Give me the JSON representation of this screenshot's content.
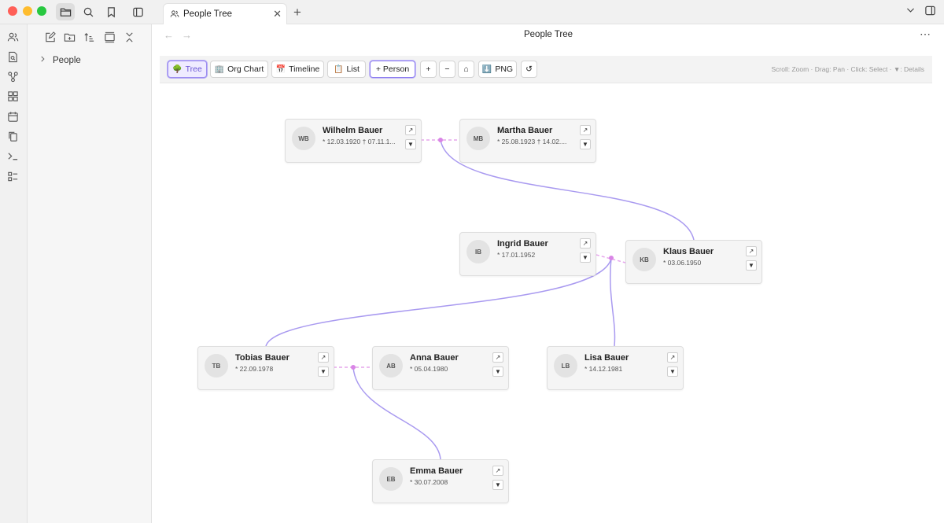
{
  "tab": {
    "title": "People Tree",
    "icon": "people-icon"
  },
  "view": {
    "title": "People Tree"
  },
  "sidebar": {
    "folders": [
      {
        "label": "People",
        "collapsed": true
      }
    ]
  },
  "toolbar": {
    "tree": "Tree",
    "org_chart": "Org Chart",
    "timeline": "Timeline",
    "list": "List",
    "add_person": "+ Person",
    "zoom_in": "+",
    "zoom_out": "−",
    "home": "⌂",
    "png": "PNG",
    "reset": "↺",
    "hint": "Scroll: Zoom · Drag: Pan · Click: Select · ▼: Details"
  },
  "card_controls": {
    "open": "↗",
    "menu": "▼"
  },
  "people": [
    {
      "id": "wb",
      "initials": "WB",
      "name": "Wilhelm Bauer",
      "dates": "* 12.03.1920 † 07.11.1..."
    },
    {
      "id": "mb",
      "initials": "MB",
      "name": "Martha Bauer",
      "dates": "* 25.08.1923 † 14.02...."
    },
    {
      "id": "ib",
      "initials": "IB",
      "name": "Ingrid Bauer",
      "dates": "* 17.01.1952"
    },
    {
      "id": "kb",
      "initials": "KB",
      "name": "Klaus Bauer",
      "dates": "* 03.06.1950"
    },
    {
      "id": "tb",
      "initials": "TB",
      "name": "Tobias Bauer",
      "dates": "* 22.09.1978"
    },
    {
      "id": "ab",
      "initials": "AB",
      "name": "Anna Bauer",
      "dates": "* 05.04.1980"
    },
    {
      "id": "lb",
      "initials": "LB",
      "name": "Lisa Bauer",
      "dates": "* 14.12.1981"
    },
    {
      "id": "eb",
      "initials": "EB",
      "name": "Emma Bauer",
      "dates": "* 30.07.2008"
    }
  ],
  "relations": {
    "couples": [
      [
        "wb",
        "mb"
      ],
      [
        "ib",
        "kb"
      ],
      [
        "tb",
        "ab"
      ]
    ],
    "parent_child": [
      [
        "wb+mb",
        "kb"
      ],
      [
        "ib+kb",
        "tb"
      ],
      [
        "ib+kb",
        "lb"
      ],
      [
        "tb+ab",
        "eb"
      ]
    ]
  },
  "colors": {
    "accent": "#8f7ff0",
    "spouse_line": "#e6a6ec",
    "child_line": "#a99af0",
    "junction": "#d985e6"
  }
}
